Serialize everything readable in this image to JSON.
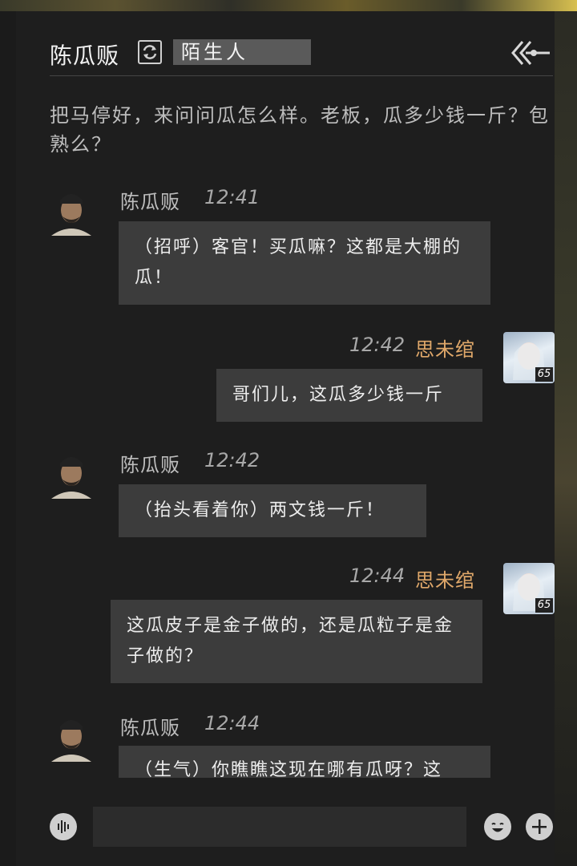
{
  "header": {
    "npc_name": "陈瓜贩",
    "relation": "陌生人"
  },
  "narration": "把马停好，来问问瓜怎么样。老板，瓜多少钱一斤？包熟么？",
  "messages": [
    {
      "side": "npc",
      "sender": "陈瓜贩",
      "time": "12:41",
      "text": "（招呼）客官！买瓜嘛？这都是大棚的瓜！"
    },
    {
      "side": "player",
      "sender": "思未绾",
      "time": "12:42",
      "level": "65",
      "text": "哥们儿，这瓜多少钱一斤"
    },
    {
      "side": "npc",
      "sender": "陈瓜贩",
      "time": "12:42",
      "text": "（抬头看着你）两文钱一斤！"
    },
    {
      "side": "player",
      "sender": "思未绾",
      "time": "12:44",
      "level": "65",
      "text": "这瓜皮子是金子做的，还是瓜粒子是金子做的？"
    },
    {
      "side": "npc",
      "sender": "陈瓜贩",
      "time": "12:44",
      "text": "（生气）你瞧瞧这现在哪有瓜呀？这"
    }
  ],
  "input": {
    "placeholder": ""
  },
  "icons": {
    "refresh": "refresh-icon",
    "back": "back-arrow-icon",
    "voice": "voice-icon",
    "emoji": "emoji-icon",
    "plus": "plus-icon"
  }
}
